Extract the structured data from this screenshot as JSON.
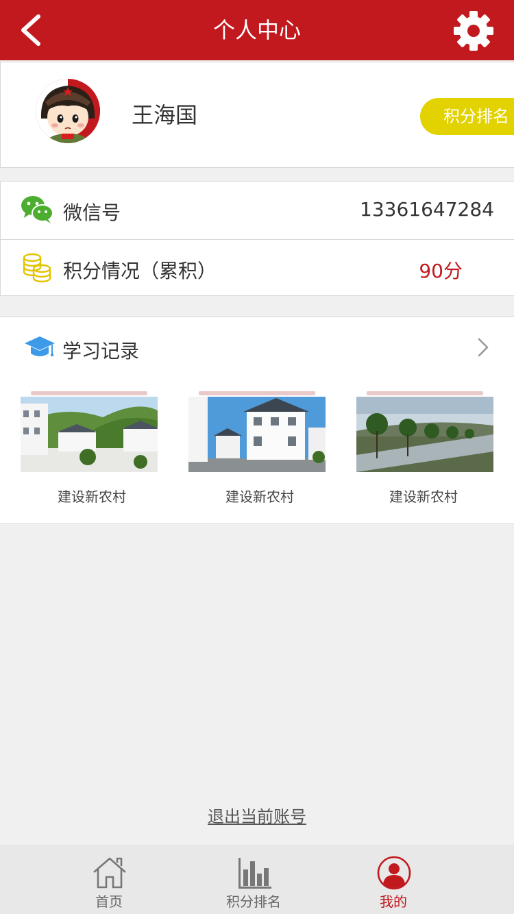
{
  "header": {
    "title": "个人中心",
    "back_icon": "chevron-left-icon",
    "settings_icon": "gear-icon",
    "background": "#c2191e"
  },
  "profile": {
    "name": "王海国",
    "rank_button": "积分排名",
    "rank_button_color": "#e2d200"
  },
  "info": {
    "wechat": {
      "label": "微信号",
      "value": "13361647284",
      "icon": "wechat-icon"
    },
    "points": {
      "label": "积分情况（累积）",
      "value": "90分",
      "icon": "coins-icon"
    }
  },
  "study": {
    "label": "学习记录",
    "icon": "graduation-cap-icon",
    "items": [
      {
        "caption": "建设新农村"
      },
      {
        "caption": "建设新农村"
      },
      {
        "caption": "建设新农村"
      }
    ]
  },
  "logout": "退出当前账号",
  "tabbar": {
    "items": [
      {
        "label": "首页",
        "icon": "home-icon"
      },
      {
        "label": "积分排名",
        "icon": "bar-chart-icon"
      },
      {
        "label": "我的",
        "icon": "user-icon"
      }
    ],
    "active_index": 2,
    "active_color": "#c2191e"
  }
}
